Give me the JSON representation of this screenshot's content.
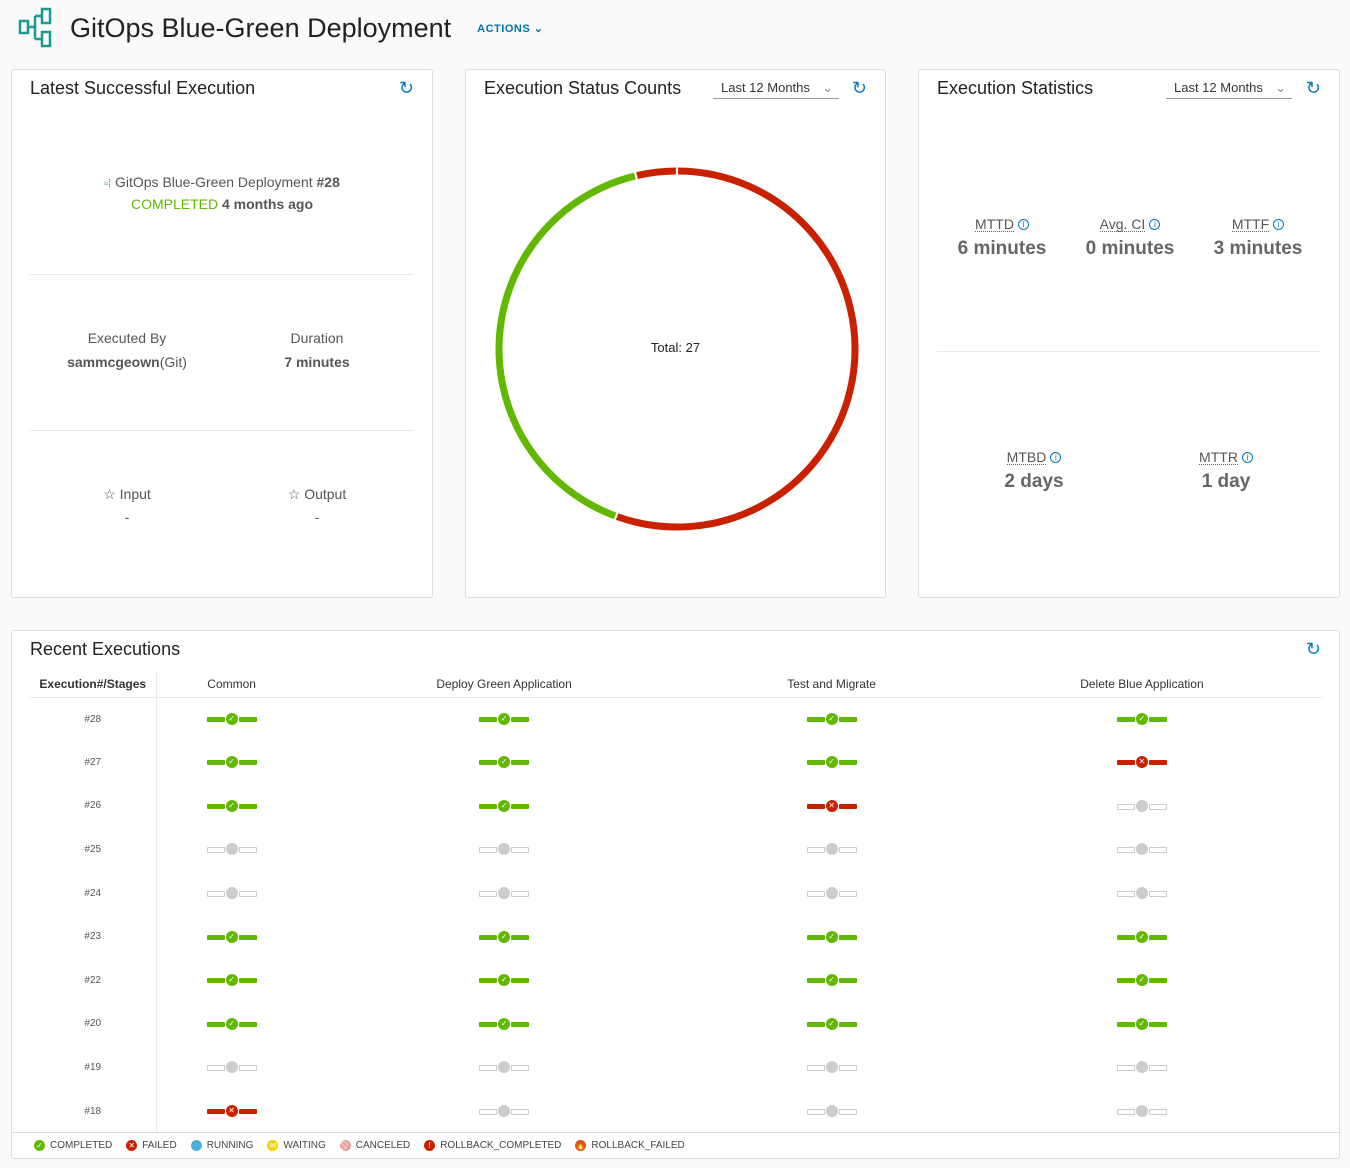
{
  "header": {
    "title": "GitOps Blue-Green Deployment",
    "actions_label": "ACTIONS"
  },
  "latest": {
    "title": "Latest Successful Execution",
    "pipeline_name": "GitOps Blue-Green Deployment",
    "run_number": "#28",
    "status": "COMPLETED",
    "ago": "4 months ago",
    "executed_by_label": "Executed By",
    "executed_by_user": "sammcgeown",
    "executed_by_source": "(Git)",
    "duration_label": "Duration",
    "duration": "7 minutes",
    "input_label": "Input",
    "input_value": "-",
    "output_label": "Output",
    "output_value": "-"
  },
  "status_counts": {
    "title": "Execution Status Counts",
    "range": "Last 12 Months",
    "total_label": "Total: 27"
  },
  "chart_data": {
    "type": "pie",
    "title": "Execution Status Counts",
    "total": 27,
    "slices": [
      {
        "label": "FAILED",
        "value": 15,
        "color": "#c92100"
      },
      {
        "label": "COMPLETED",
        "value": 11,
        "color": "#62b800"
      },
      {
        "label": "FAILED",
        "value": 1,
        "color": "#c92100"
      }
    ]
  },
  "stats": {
    "title": "Execution Statistics",
    "range": "Last 12 Months",
    "items": [
      {
        "key": "MTTD",
        "value": "6 minutes"
      },
      {
        "key": "Avg. CI",
        "value": "0 minutes"
      },
      {
        "key": "MTTF",
        "value": "3 minutes"
      },
      {
        "key": "MTBD",
        "value": "2 days"
      },
      {
        "key": "MTTR",
        "value": "1 day"
      }
    ]
  },
  "recent": {
    "title": "Recent Executions",
    "header": "Execution#/Stages",
    "stages": [
      "Common",
      "Deploy Green Application",
      "Test and Migrate",
      "Delete Blue Application"
    ],
    "rows": [
      {
        "id": "#28",
        "s": [
          "completed",
          "completed",
          "completed",
          "completed"
        ]
      },
      {
        "id": "#27",
        "s": [
          "completed",
          "completed",
          "completed",
          "failed"
        ]
      },
      {
        "id": "#26",
        "s": [
          "completed",
          "completed",
          "failed",
          "none"
        ]
      },
      {
        "id": "#25",
        "s": [
          "none",
          "none",
          "none",
          "none"
        ]
      },
      {
        "id": "#24",
        "s": [
          "none",
          "none",
          "none",
          "none"
        ]
      },
      {
        "id": "#23",
        "s": [
          "completed",
          "completed",
          "completed",
          "completed"
        ]
      },
      {
        "id": "#22",
        "s": [
          "completed",
          "completed",
          "completed",
          "completed"
        ]
      },
      {
        "id": "#20",
        "s": [
          "completed",
          "completed",
          "completed",
          "completed"
        ]
      },
      {
        "id": "#19",
        "s": [
          "none",
          "none",
          "none",
          "none"
        ]
      },
      {
        "id": "#18",
        "s": [
          "failed",
          "none",
          "none",
          "none"
        ]
      }
    ]
  },
  "legend": [
    {
      "label": "COMPLETED",
      "color": "#62b800",
      "icon": "✓"
    },
    {
      "label": "FAILED",
      "color": "#c92100",
      "icon": "✕"
    },
    {
      "label": "RUNNING",
      "color": "#49afd9",
      "icon": ""
    },
    {
      "label": "WAITING",
      "color": "#f5d000",
      "icon": "✉"
    },
    {
      "label": "CANCELED",
      "color": "#e8a09a",
      "icon": "⃠"
    },
    {
      "label": "ROLLBACK_COMPLETED",
      "color": "#c92100",
      "icon": "!"
    },
    {
      "label": "ROLLBACK_FAILED",
      "color": "#e04e1a",
      "icon": "🔥"
    }
  ]
}
